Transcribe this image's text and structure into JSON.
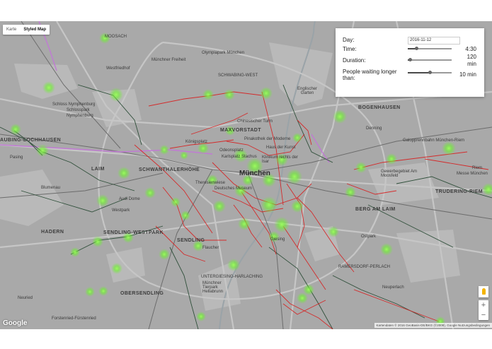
{
  "map_type": {
    "map_label": "Karte",
    "styled_label": "Styled Map",
    "active": "Styled Map"
  },
  "panel": {
    "day_label": "Day:",
    "day_value": "2016-11-12",
    "time_label": "Time:",
    "time_value": "4:30",
    "time_fraction": 0.2,
    "duration_label": "Duration:",
    "duration_value": "120",
    "duration_unit": "min",
    "duration_fraction": 0.05,
    "waiting_label_line1": "People waiting longer",
    "waiting_label_line2": "than:",
    "waiting_value": "10 min",
    "waiting_fraction": 0.5
  },
  "place_labels": {
    "moosach": "MOOSACH",
    "olympiapark": "Olympiapark München",
    "westfriedhof": "Westfriedhof",
    "muenchner_freiheit": "Münchner Freiheit",
    "schwabing_west": "SCHWABING-WEST",
    "englischer_garten": "Englischer Garten",
    "schloss1": "Schloss Nymphenburg",
    "schloss2": "Schlosspark",
    "schloss3": "Nymphenburg",
    "bogenhausen": "BOGENHAUSEN",
    "chinesischer_turm": "Chinesischer Turm",
    "maxvorstadt": "MAXVORSTADT",
    "pinakothek": "Pinakothek der Moderne",
    "denning": "Denning",
    "koenigsplatz": "Königsplatz",
    "haus_der_kunst": "Haus der Kunst",
    "galopprennbahn": "Galopprennbahn München-Riem",
    "neuhausen": "NEUHAUSEN",
    "odeonsplatz": "Odeonsplatz",
    "karlsplatz": "Karlsplatz Stachus",
    "klinikum": "Klinikum rechts der Isar",
    "pasing": "Pasing",
    "laim": "LAIM",
    "schwanthalerhoehe": "SCHWANTHALERHÖHE",
    "muenchen": "München",
    "gewerbegebiet": "Gewerbegebiet Am Moosfeld",
    "riem": "Riem",
    "messe": "Messe München",
    "blumenau": "Blumenau",
    "theresienwiese": "Theresienwiese",
    "deutsches_museum": "Deutsches Museum",
    "truderng_riem": "TRUDERING-RIEM",
    "audi_dome": "Audi Dome",
    "berg_am_laim": "BERG AM LAIM",
    "westpark": "Westpark",
    "hadern": "HADERN",
    "sendling_westpark": "SENDLING-WESTPARK",
    "sendling": "SENDLING",
    "giesing": "Giesing",
    "ostpark": "Ostpark",
    "flaucher": "Flaucher",
    "ramersdorf": "RAMERSDORF-PERLACH",
    "untergiesing": "UNTERGIESING-HARLACHING",
    "tierpark": "Münchner Tierpark Hellabrunn",
    "obersendling": "OBERSENDLING",
    "neuried": "Neuried",
    "neuperlach": "Neuperlach",
    "forstenried": "Forstenried-Fürstenried",
    "aubing": "AUBING-LOCHHAUSEN"
  },
  "controls": {
    "zoom_in": "+",
    "zoom_out": "−"
  },
  "google_logo": "Google",
  "attribution": "Kartendaten © 2016 GeoBasis-DE/BKG (©2009), Google    Nutzungsbedingungen",
  "colors": {
    "map_background": "#a9a9a9",
    "hotspot": "#7cfc3a",
    "route_hot": "#d81e1e",
    "route_dark": "#2f4f3a",
    "rail": "#6c6c6c",
    "ubahn_pink": "#c17ad4"
  }
}
